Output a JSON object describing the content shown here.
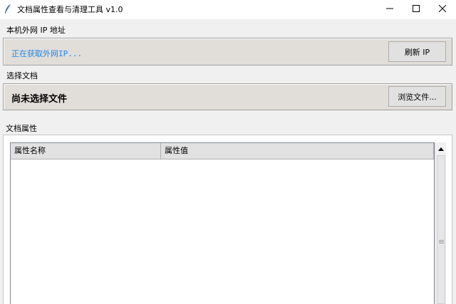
{
  "window": {
    "title": "文档属性查看与清理工具 v1.0",
    "controls": [
      "minimize",
      "maximize",
      "close"
    ]
  },
  "ip_section": {
    "label": "本机外网 IP 地址",
    "status": "正在获取外网IP...",
    "status_color": "#1e88e5",
    "refresh_button": "刷新 IP"
  },
  "file_section": {
    "label": "选择文档",
    "status": "尚未选择文件",
    "browse_button": "浏览文件..."
  },
  "properties_section": {
    "label": "文档属性",
    "columns": [
      "属性名称",
      "属性值"
    ],
    "rows": []
  },
  "icons": {
    "app": "feather-icon",
    "minimize": "minimize-icon",
    "maximize": "maximize-icon",
    "close": "close-icon",
    "scroll_up": "arrow-up-icon"
  }
}
